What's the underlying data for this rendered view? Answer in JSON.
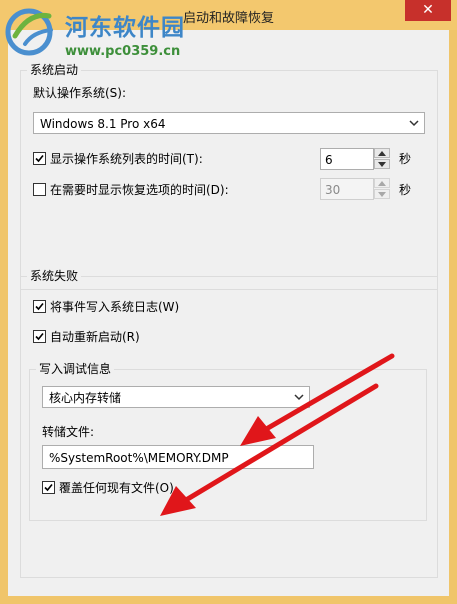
{
  "window": {
    "title": "启动和故障恢复",
    "close_glyph": "✕"
  },
  "watermark": {
    "site_name": "河东软件园",
    "url": "www.pc0359.cn"
  },
  "system_startup": {
    "group_label": "系统启动",
    "default_os_label": "默认操作系统(S):",
    "default_os_value": "Windows 8.1 Pro x64",
    "show_os_list": {
      "label": "显示操作系统列表的时间(T):",
      "checked": true,
      "value": "6",
      "unit": "秒"
    },
    "show_recovery": {
      "label": "在需要时显示恢复选项的时间(D):",
      "checked": false,
      "value": "30",
      "unit": "秒"
    }
  },
  "system_failure": {
    "group_label": "系统失败",
    "write_event_log": {
      "label": "将事件写入系统日志(W)",
      "checked": true
    },
    "auto_restart": {
      "label": "自动重新启动(R)",
      "checked": true
    },
    "debug_info": {
      "group_label": "写入调试信息",
      "dump_type": "核心内存转储",
      "dump_file_label": "转储文件:",
      "dump_file_value": "%SystemRoot%\\MEMORY.DMP",
      "overwrite": {
        "label": "覆盖任何现有文件(O)",
        "checked": true
      }
    }
  },
  "annotation_color": "#e0161a"
}
